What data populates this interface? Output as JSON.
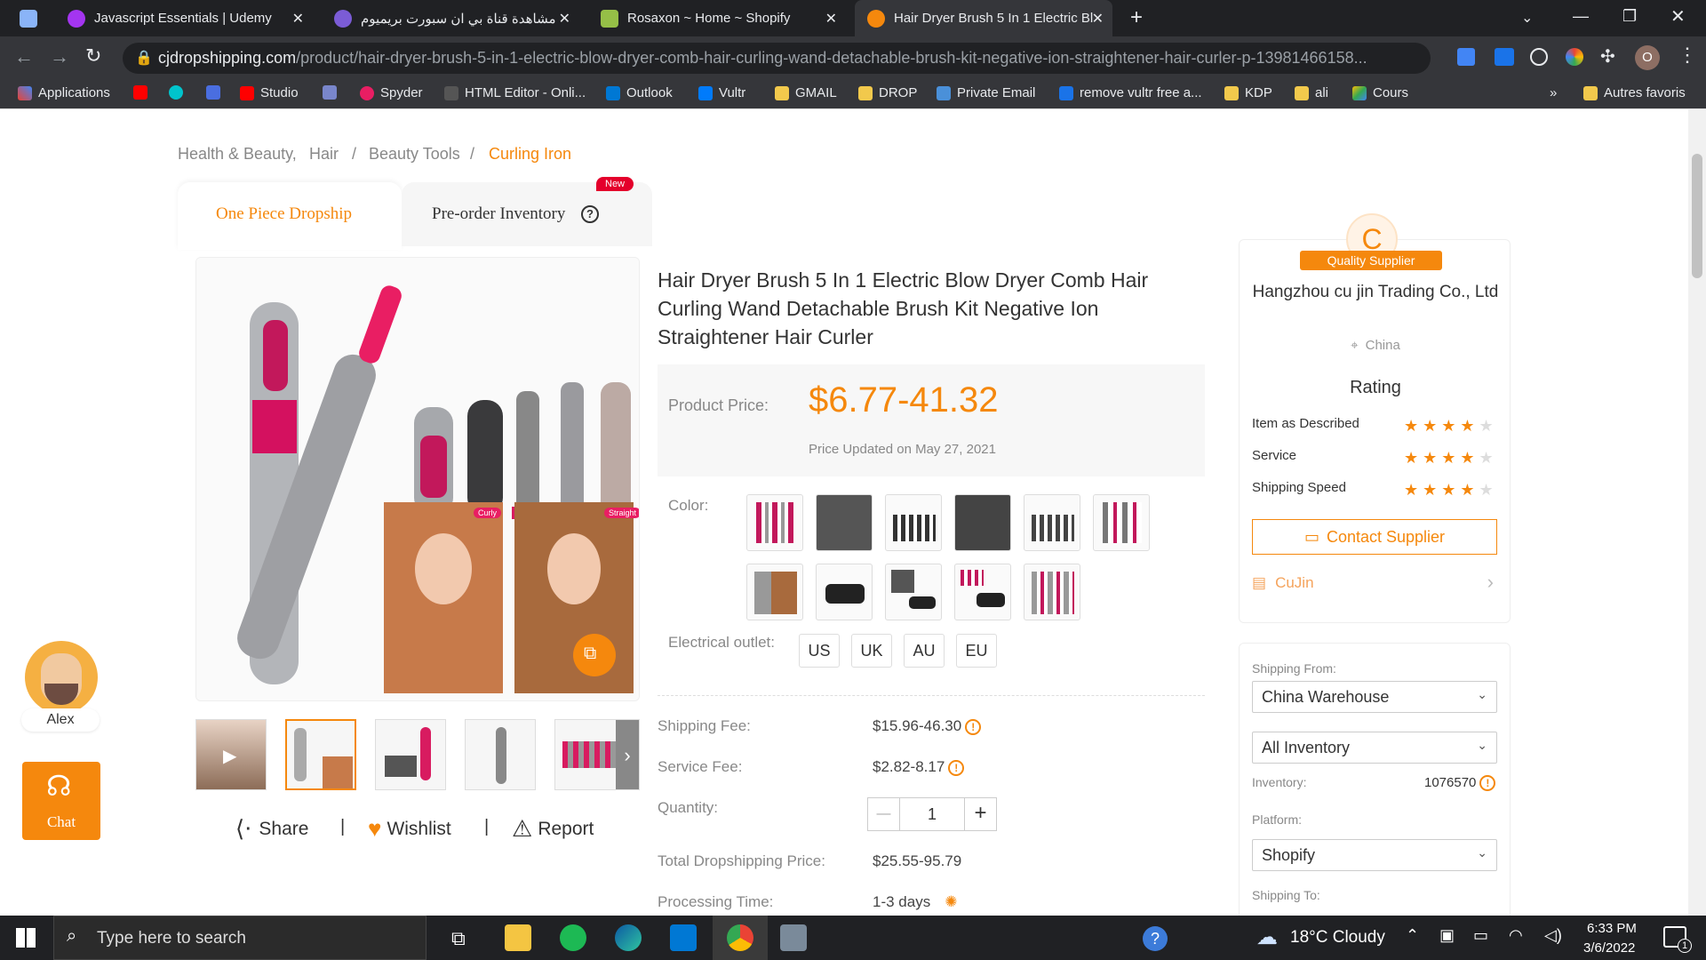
{
  "browser": {
    "tabs": [
      {
        "title": "",
        "active": false
      },
      {
        "title": "Javascript Essentials | Udemy",
        "active": false
      },
      {
        "title": "مشاهدة قناة بي ان سبورت بريميوم",
        "active": false
      },
      {
        "title": "Rosaxon ~ Home ~ Shopify",
        "active": false
      },
      {
        "title": "Hair Dryer Brush 5 In 1 Electric Bl",
        "active": true
      }
    ],
    "url_host": "cjdropshipping.com",
    "url_path": "/product/hair-dryer-brush-5-in-1-electric-blow-dryer-comb-hair-curling-wand-detachable-brush-kit-negative-ion-straightener-hair-curler-p-13981466158...",
    "profile_initial": "O",
    "bookmarks": [
      "Applications",
      "Studio",
      "Spyder",
      "HTML Editor - Onli...",
      "Outlook",
      "Vultr",
      "GMAIL",
      "DROP",
      "Private Email",
      "remove vultr free a...",
      "KDP",
      "ali",
      "Cours"
    ],
    "bookmarks_more": "»",
    "other_bookmarks": "Autres favoris"
  },
  "breadcrumb": {
    "items": [
      "Health & Beauty,",
      "Hair",
      "Beauty Tools"
    ],
    "current": "Curling Iron",
    "sep": "/"
  },
  "mode_tabs": {
    "dropship": "One Piece Dropship",
    "preorder": "Pre-order Inventory",
    "new_badge": "New"
  },
  "product": {
    "title": "Hair Dryer Brush 5 In 1 Electric Blow Dryer Comb Hair Curling Wand Detachable Brush Kit Negative Ion Straightener Hair Curler",
    "price_label": "Product Price:",
    "price": "$6.77-41.32",
    "price_updated": "Price Updated on May 27, 2021",
    "color_label": "Color:",
    "outlet_label": "Electrical outlet:",
    "outlets": [
      "US",
      "UK",
      "AU",
      "EU"
    ],
    "image_tags": [
      "Curly",
      "Straight"
    ],
    "shipping_fee_label": "Shipping Fee:",
    "shipping_fee": "$15.96-46.30",
    "service_fee_label": "Service Fee:",
    "service_fee": "$2.82-8.17",
    "quantity_label": "Quantity:",
    "quantity": "1",
    "qty_minus": "—",
    "qty_plus": "+",
    "total_label": "Total Dropshipping Price:",
    "total": "$25.55-95.79",
    "processing_label": "Processing Time:",
    "processing": "1-3 days"
  },
  "actions": {
    "share": "Share",
    "wishlist": "Wishlist",
    "report": "Report",
    "sep": "|"
  },
  "supplier": {
    "badge_letter": "C",
    "badge_text": "Quality Supplier",
    "name": "Hangzhou cu jin Trading Co., Ltd",
    "country": "China",
    "rating_title": "Rating",
    "ratings": [
      {
        "label": "Item as Described",
        "stars": 4
      },
      {
        "label": "Service",
        "stars": 4
      },
      {
        "label": "Shipping Speed",
        "stars": 4
      }
    ],
    "contact": "Contact Supplier",
    "store": "CuJin"
  },
  "shipping": {
    "from_label": "Shipping From:",
    "from": "China Warehouse",
    "inventory_filter": "All Inventory",
    "inventory_label": "Inventory:",
    "inventory": "1076570",
    "platform_label": "Platform:",
    "platform": "Shopify",
    "to_label": "Shipping To:"
  },
  "chat": {
    "agent": "Alex",
    "label": "Chat"
  },
  "taskbar": {
    "search": "Type here to search",
    "weather": "18°C  Cloudy",
    "time": "6:33 PM",
    "date": "3/6/2022",
    "notif": "1"
  },
  "colors": {
    "accent": "#f5880d",
    "chrome_dark": "#202124",
    "chrome_mid": "#35363a"
  }
}
